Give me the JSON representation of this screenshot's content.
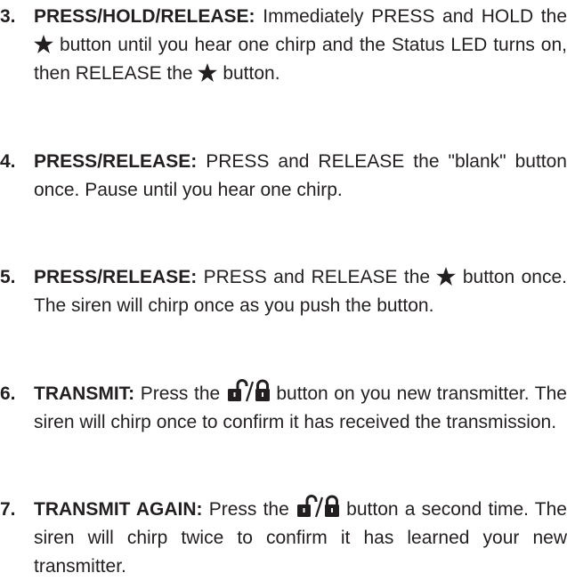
{
  "steps": [
    {
      "number": "3.",
      "heading": "PRESS/HOLD/RELEASE:",
      "text_a": "Immediately PRESS and HOLD the",
      "icon_a": "star-icon",
      "text_b": "button until you hear one chirp and the Status LED turns on, then RELEASE the",
      "icon_b": "star-icon",
      "text_c": "button."
    },
    {
      "number": "4.",
      "heading": "PRESS/RELEASE:",
      "text_a": "PRESS and RELEASE the \"blank\" button once. Pause until you hear one chirp."
    },
    {
      "number": "5.",
      "heading": "PRESS/RELEASE:",
      "text_a": "PRESS and RELEASE the",
      "icon_a": "star-icon",
      "text_b": "button once. The siren will chirp once as you push the button."
    },
    {
      "number": "6.",
      "heading": "TRANSMIT:",
      "text_a": "Press the",
      "icon_a": "lock-unlock-icon",
      "text_b": "button on you new transmitter. The siren will chirp once to confirm it has received the transmission."
    },
    {
      "number": "7.",
      "heading": "TRANSMIT AGAIN:",
      "text_a": "Press the",
      "icon_a": "lock-unlock-icon",
      "text_b": "button a second time. The siren will chirp twice to confirm it has learned your new transmitter."
    }
  ],
  "colors": {
    "text": "#231f20",
    "background": "#ffffff"
  }
}
